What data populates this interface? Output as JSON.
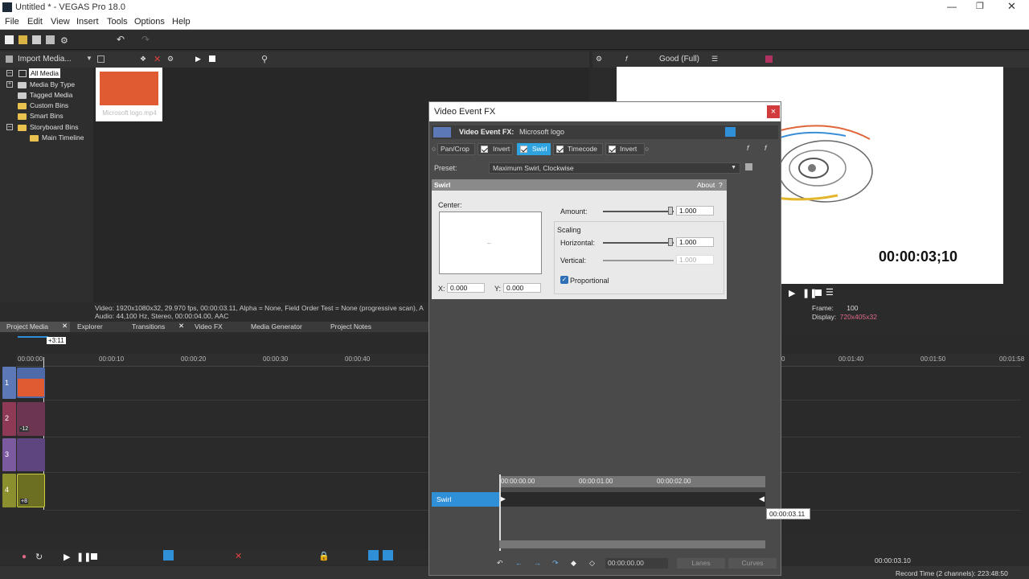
{
  "app": {
    "title": "Untitled * - VEGAS Pro 18.0"
  },
  "menu": [
    "File",
    "Edit",
    "View",
    "Insert",
    "Tools",
    "Options",
    "Help"
  ],
  "media_toolbar": {
    "import_label": "Import Media..."
  },
  "tree": {
    "items": [
      {
        "label": "All Media",
        "selected": true
      },
      {
        "label": "Media By Type"
      },
      {
        "label": "Tagged Media"
      },
      {
        "label": "Custom Bins"
      },
      {
        "label": "Smart Bins"
      },
      {
        "label": "Storyboard Bins"
      },
      {
        "label": "Main Timeline"
      }
    ]
  },
  "thumbnail": {
    "caption": "Microsoft logo.mp4",
    "color": "#e05a32"
  },
  "media_info": {
    "line1": "Video: 1920x1080x32, 29.970 fps, 00:00:03.11, Alpha = None, Field Order Test = None (progressive scan), A",
    "line2": "Audio: 44,100 Hz, Stereo, 00:00:04.00, AAC"
  },
  "tabs": [
    "Project Media",
    "Explorer",
    "Transitions",
    "Video FX",
    "Media Generator",
    "Project Notes"
  ],
  "preview": {
    "quality": "Good (Full)",
    "timecode": "00:00:03;10",
    "frame_label": "Frame:",
    "frame_value": "100",
    "display_label": "Display:",
    "display_value": "720x405x32"
  },
  "timeline": {
    "cursor_label": "+3:11",
    "ruler_labels": [
      "00:00:00",
      "00:00:10",
      "00:00:20",
      "00:00:30",
      "00:00:40",
      "0",
      "00:01:40",
      "00:01:50",
      "00:01:58"
    ],
    "tracks": [
      {
        "number": "1",
        "color": "#5c78b6"
      },
      {
        "number": "2",
        "color": "#8e3a57",
        "badge": "-12"
      },
      {
        "number": "3",
        "color": "#7b5aa0"
      },
      {
        "number": "4",
        "color": "#8c8f2e",
        "badge": "+8"
      }
    ]
  },
  "status": {
    "timecode": "00:00:03.10",
    "record_time": "Record Time (2 channels): 223:48:50"
  },
  "dialog": {
    "title": "Video Event FX",
    "close": "×",
    "fx_header_bold": "Video Event FX:",
    "fx_header_name": "Microsoft logo",
    "chain": [
      {
        "label": "Pan/Crop",
        "checkbox": false
      },
      {
        "label": "Invert",
        "checkbox": true
      },
      {
        "label": "Swirl",
        "checkbox": true,
        "active": true
      },
      {
        "label": "Timecode",
        "checkbox": true
      },
      {
        "label": "Invert",
        "checkbox": true
      }
    ],
    "preset_label": "Preset:",
    "preset_value": "Maximum Swirl, Clockwise",
    "swirl": {
      "title": "Swirl",
      "about": "About",
      "help": "?",
      "center_label": "Center:",
      "x_label": "X:",
      "x_value": "0.000",
      "y_label": "Y:",
      "y_value": "0.000",
      "amount_label": "Amount:",
      "amount_value": "1.000",
      "scaling_label": "Scaling",
      "horizontal_label": "Horizontal:",
      "horizontal_value": "1.000",
      "vertical_label": "Vertical:",
      "vertical_value": "1.000",
      "proportional_label": "Proportional",
      "proportional_checked": true
    },
    "keyframes": {
      "label": "Swirl",
      "ruler": [
        "00:00:00.00",
        "00:00:01.00",
        "00:00:02.00"
      ],
      "tooltip": "00:00:03.11",
      "time_value": "00:00:00.00",
      "lanes_label": "Lanes",
      "curves_label": "Curves"
    }
  }
}
